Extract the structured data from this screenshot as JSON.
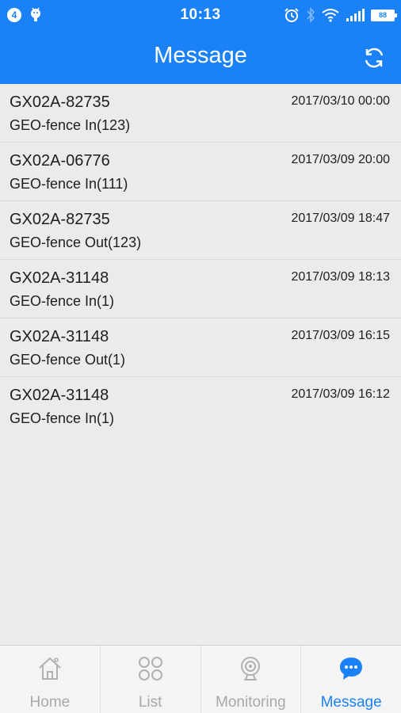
{
  "status_bar": {
    "notification_count": "4",
    "time": "10:13",
    "battery": "88"
  },
  "header": {
    "title": "Message"
  },
  "messages": [
    {
      "device": "GX02A-82735",
      "event": "GEO-fence In(123)",
      "time": "2017/03/10 00:00"
    },
    {
      "device": "GX02A-06776",
      "event": "GEO-fence In(111)",
      "time": "2017/03/09 20:00"
    },
    {
      "device": "GX02A-82735",
      "event": "GEO-fence Out(123)",
      "time": "2017/03/09 18:47"
    },
    {
      "device": "GX02A-31148",
      "event": "GEO-fence In(1)",
      "time": "2017/03/09 18:13"
    },
    {
      "device": "GX02A-31148",
      "event": "GEO-fence Out(1)",
      "time": "2017/03/09 16:15"
    },
    {
      "device": "GX02A-31148",
      "event": "GEO-fence In(1)",
      "time": "2017/03/09 16:12"
    }
  ],
  "tabs": [
    {
      "label": "Home",
      "icon": "home-icon",
      "active": false
    },
    {
      "label": "List",
      "icon": "grid-icon",
      "active": false
    },
    {
      "label": "Monitoring",
      "icon": "camera-icon",
      "active": false
    },
    {
      "label": "Message",
      "icon": "chat-bubble-icon",
      "active": true
    }
  ],
  "colors": {
    "accent": "#1a82f6",
    "background": "#ebebeb",
    "inactive_tab": "#a8a8a8"
  }
}
